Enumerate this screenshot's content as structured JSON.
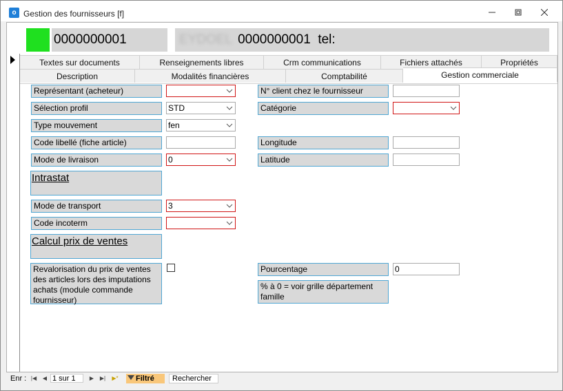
{
  "window": {
    "title": "Gestion des fournisseurs [f]",
    "icon": "app-icon"
  },
  "header": {
    "code": "0000000001",
    "name_blurred": "EYDOEL",
    "name_code": "0000000001",
    "tel": "tel:"
  },
  "tabs_row1": [
    "Textes sur documents",
    "Renseignements libres",
    "Crm communications",
    "Fichiers attachés",
    "Propriétés"
  ],
  "tabs_row2": [
    "Description",
    "Modalités financières",
    "Comptabilité",
    "Gestion commerciale"
  ],
  "form": {
    "representant_label": "Représentant (acheteur)",
    "representant_value": "",
    "profil_label": "Sélection profil",
    "profil_value": "STD",
    "mouvement_label": "Type mouvement",
    "mouvement_value": "fen",
    "code_libelle_label": "Code libellé (fiche article)",
    "code_libelle_value": "",
    "livraison_label": "Mode de livraison",
    "livraison_value": "0",
    "intrastat_title": "Intrastat",
    "transport_label": "Mode de transport",
    "transport_value": "3",
    "incoterm_label": "Code incoterm",
    "incoterm_value": "",
    "calcul_title": "Calcul prix de ventes",
    "revalorisation_label": "Revalorisation du prix de ventes des articles lors des imputations achats (module commande fournisseur)",
    "num_client_label": "N° client chez le fournisseur",
    "num_client_value": "",
    "categorie_label": "Catégorie",
    "categorie_value": "",
    "longitude_label": "Longitude",
    "longitude_value": "",
    "latitude_label": "Latitude",
    "latitude_value": "",
    "pourcentage_label": "Pourcentage",
    "pourcentage_value": "0",
    "pourcentage_note": "% à 0 = voir grille département famille"
  },
  "navbar": {
    "enr_label": "Enr :",
    "record": "1 sur 1",
    "filtre": "Filtré",
    "search": "Rechercher"
  }
}
